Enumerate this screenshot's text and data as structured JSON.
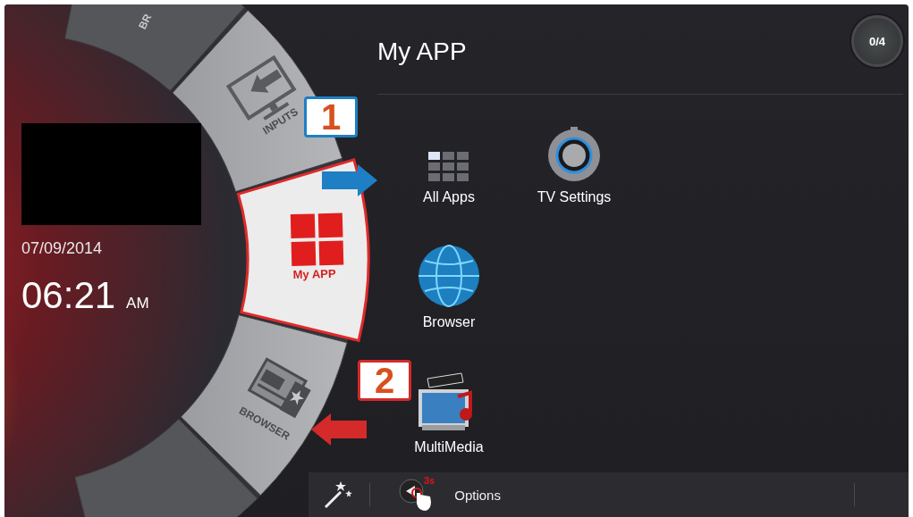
{
  "wheel": {
    "items": [
      {
        "label": "BR",
        "selected": false
      },
      {
        "label": "INPUTS",
        "selected": false
      },
      {
        "label": "My APP",
        "selected": true
      },
      {
        "label": "BROWSER",
        "selected": false
      }
    ]
  },
  "clock": {
    "date": "07/09/2014",
    "time": "06:21",
    "meridiem": "AM"
  },
  "header": {
    "title": "My APP",
    "counter": "0/4"
  },
  "app_rows": [
    [
      {
        "label": "All Apps"
      },
      {
        "label": "TV Settings"
      }
    ],
    [
      {
        "label": "Browser"
      }
    ],
    [
      {
        "label": "MultiMedia"
      }
    ]
  ],
  "callouts": [
    {
      "number": "1",
      "color": "#1e7fc4",
      "kind": "right"
    },
    {
      "number": "2",
      "color": "#d42a2a",
      "kind": "left"
    }
  ],
  "bottom_bar": {
    "hold_time": "3s",
    "options_label": "Options"
  }
}
